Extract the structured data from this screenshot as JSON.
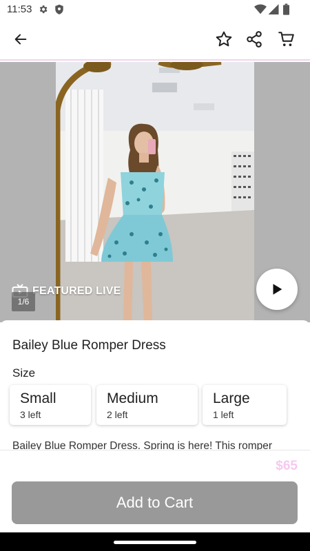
{
  "status_bar": {
    "time": "11:53"
  },
  "media": {
    "featured_label": "FEATURED LIVE",
    "image_counter": "1/6"
  },
  "product": {
    "title": "Bailey Blue Romper Dress",
    "size_label": "Size",
    "sizes": [
      {
        "name": "Small",
        "stock": "3 left"
      },
      {
        "name": "Medium",
        "stock": "2 left"
      },
      {
        "name": "Large",
        "stock": "1 left"
      }
    ],
    "description": "Bailey Blue Romper Dress. Spring is here! This romper"
  },
  "footer": {
    "price": "$65",
    "add_to_cart_label": "Add to Cart"
  },
  "colors": {
    "accent_pink": "#f6c8ef",
    "button_disabled": "#999999"
  }
}
